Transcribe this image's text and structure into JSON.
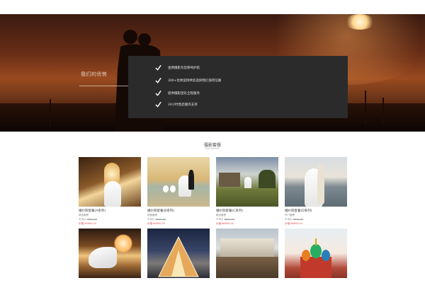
{
  "hero": {
    "title": "我们的优势",
    "features": [
      "金牌摄影为您保驾护航",
      "300+优秀案例供您选择我们值得信赖",
      "提供摄影团队全程服务",
      "24小时售后服务支持"
    ]
  },
  "section": {
    "title": "摄影套餐",
    "subtitle": "PACKAGE"
  },
  "packages": [
    {
      "title": "婚纱照套餐(A系列)",
      "subtitle": "精选套餐",
      "old_price_label": "市场价:",
      "old_price": "4800.00",
      "price_label": "价格:",
      "price": "¥3600.00"
    },
    {
      "title": "婚纱照套餐(B系列)",
      "subtitle": "超值套餐",
      "old_price_label": "市场价:",
      "old_price": "6800.00",
      "price_label": "价格:",
      "price": "¥4800.00"
    },
    {
      "title": "婚纱照套餐(C系列)",
      "subtitle": "精选套餐",
      "old_price_label": "市场价:",
      "old_price": "8800.00",
      "price_label": "价格:",
      "price": "¥6800.00"
    },
    {
      "title": "婚纱照套餐(D系列)",
      "subtitle": "热门套餐",
      "old_price_label": "市场价:",
      "old_price": "9800.00",
      "price_label": "价格:",
      "price": "¥6800.00"
    },
    {
      "title": "",
      "subtitle": "",
      "old_price_label": "",
      "old_price": "",
      "price_label": "",
      "price": ""
    },
    {
      "title": "",
      "subtitle": "",
      "old_price_label": "",
      "old_price": "",
      "price_label": "",
      "price": ""
    },
    {
      "title": "",
      "subtitle": "",
      "old_price_label": "",
      "old_price": "",
      "price_label": "",
      "price": ""
    },
    {
      "title": "",
      "subtitle": "",
      "old_price_label": "",
      "old_price": "",
      "price_label": "",
      "price": ""
    }
  ],
  "colors": {
    "panel": "#2b2b2b",
    "price": "#d9534f",
    "accent_text": "#e6e6e6"
  },
  "icons": {
    "feature": "check-icon"
  }
}
